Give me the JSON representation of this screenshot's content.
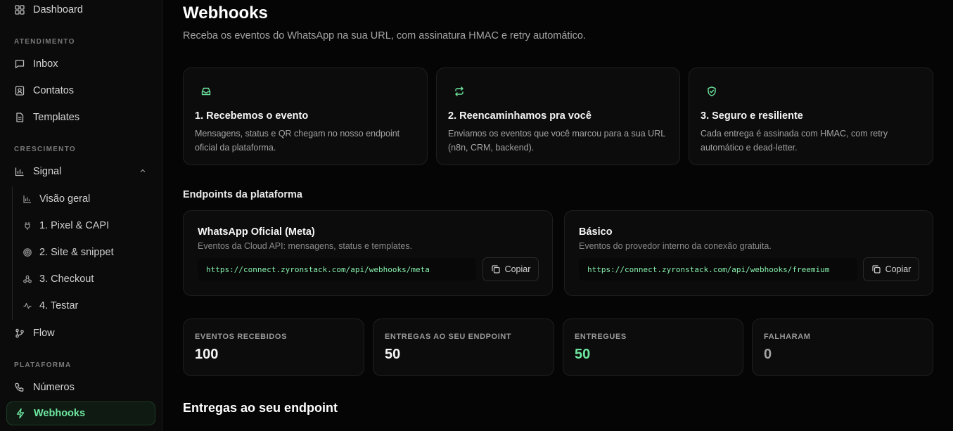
{
  "sidebar": {
    "dashboard": "Dashboard",
    "section_atendimento": "ATENDIMENTO",
    "inbox": "Inbox",
    "contatos": "Contatos",
    "templates": "Templates",
    "section_crescimento": "CRESCIMENTO",
    "signal": "Signal",
    "signal_sub": [
      "Visão geral",
      "1. Pixel & CAPI",
      "2. Site & snippet",
      "3. Checkout",
      "4. Testar"
    ],
    "flow": "Flow",
    "section_plataforma": "PLATAFORMA",
    "numeros": "Números",
    "webhooks": "Webhooks"
  },
  "page": {
    "title": "Webhooks",
    "subtitle": "Receba os eventos do WhatsApp na sua URL, com assinatura HMAC e retry automático."
  },
  "features": [
    {
      "icon": "inbox-icon",
      "title": "1. Recebemos o evento",
      "desc": "Mensagens, status e QR chegam no nosso endpoint oficial da plataforma."
    },
    {
      "icon": "repeat-icon",
      "title": "2. Reencaminhamos pra você",
      "desc": "Enviamos os eventos que você marcou para a sua URL (n8n, CRM, backend)."
    },
    {
      "icon": "shield-check-icon",
      "title": "3. Seguro e resiliente",
      "desc": "Cada entrega é assinada com HMAC, com retry automático e dead-letter."
    }
  ],
  "endpoints_title": "Endpoints da plataforma",
  "endpoints": [
    {
      "title": "WhatsApp Oficial (Meta)",
      "desc": "Eventos da Cloud API: mensagens, status e templates.",
      "url": "https://connect.zyronstack.com/api/webhooks/meta",
      "copy_label": "Copiar"
    },
    {
      "title": "Básico",
      "desc": "Eventos do provedor interno da conexão gratuita.",
      "url": "https://connect.zyronstack.com/api/webhooks/freemium",
      "copy_label": "Copiar"
    }
  ],
  "stats": [
    {
      "label": "EVENTOS RECEBIDOS",
      "value": "100"
    },
    {
      "label": "ENTREGAS AO SEU ENDPOINT",
      "value": "50"
    },
    {
      "label": "ENTREGUES",
      "value": "50"
    },
    {
      "label": "FALHARAM",
      "value": "0"
    }
  ],
  "deliveries_title": "Entregas ao seu endpoint",
  "colors": {
    "accent": "#6ee7a0",
    "background": "#050505"
  }
}
